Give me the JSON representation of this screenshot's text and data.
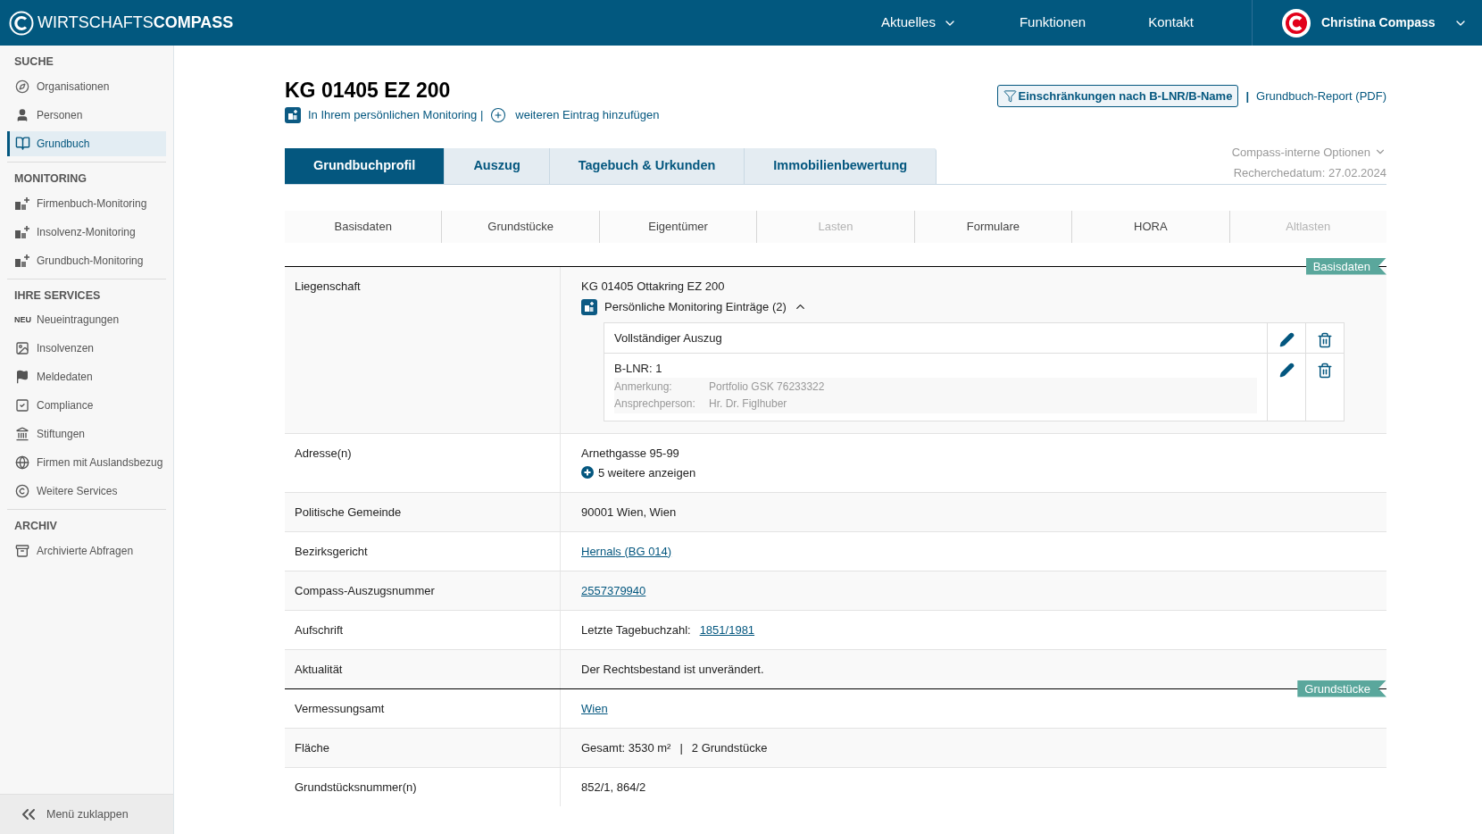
{
  "header": {
    "logo": {
      "light": "WIRTSCHAFTS",
      "bold": "COMPASS"
    },
    "nav": [
      {
        "label": "Aktuelles",
        "dropdown": true
      },
      {
        "label": "Funktionen",
        "dropdown": false
      },
      {
        "label": "Kontakt",
        "dropdown": false
      }
    ],
    "user": {
      "name": "Christina Compass"
    }
  },
  "sidebar": {
    "sections": [
      {
        "title": "SUCHE",
        "items": [
          {
            "label": "Organisationen",
            "selected": false
          },
          {
            "label": "Personen",
            "selected": false
          },
          {
            "label": "Grundbuch",
            "selected": true
          }
        ]
      },
      {
        "title": "MONITORING",
        "items": [
          {
            "label": "Firmenbuch-Monitoring",
            "selected": false
          },
          {
            "label": "Insolvenz-Monitoring",
            "selected": false
          },
          {
            "label": "Grundbuch-Monitoring",
            "selected": false
          }
        ]
      },
      {
        "title": "IHRE SERVICES",
        "items": [
          {
            "label": "Neueintragungen",
            "badge": "NEU",
            "selected": false
          },
          {
            "label": "Insolvenzen",
            "selected": false
          },
          {
            "label": "Meldedaten",
            "selected": false
          },
          {
            "label": "Compliance",
            "selected": false
          },
          {
            "label": "Stiftungen",
            "selected": false
          },
          {
            "label": "Firmen mit Auslandsbezug",
            "selected": false
          },
          {
            "label": "Weitere Services",
            "selected": false
          }
        ]
      },
      {
        "title": "ARCHIV",
        "items": [
          {
            "label": "Archivierte Abfragen",
            "selected": false
          }
        ]
      }
    ],
    "collapse": "Menü zuklappen"
  },
  "page": {
    "title": "KG 01405 EZ 200",
    "monitoring_link": "In Ihrem persönlichen Monitoring |",
    "add_link": "weiteren Eintrag hinzufügen",
    "filter_button": "Einschränkungen nach B-LNR/B-Name",
    "separator": "|",
    "report_link": "Grundbuch-Report (PDF)",
    "tabs": [
      {
        "label": "Grundbuchprofil",
        "selected": true
      },
      {
        "label": "Auszug",
        "selected": false
      },
      {
        "label": "Tagebuch & Urkunden",
        "selected": false
      },
      {
        "label": "Immobilienbewertung",
        "selected": false
      }
    ],
    "options": "Compass-interne Optionen",
    "research_date": "Recherchedatum: 27.02.2024",
    "subtabs": [
      {
        "label": "Basisdaten",
        "disabled": false
      },
      {
        "label": "Grundstücke",
        "disabled": false
      },
      {
        "label": "Eigentümer",
        "disabled": false
      },
      {
        "label": "Lasten",
        "disabled": true
      },
      {
        "label": "Formulare",
        "disabled": false
      },
      {
        "label": "HORA",
        "disabled": false
      },
      {
        "label": "Altlasten",
        "disabled": true
      }
    ],
    "rows": [
      {
        "label": "Liegenschaft",
        "section": "Basisdaten",
        "value": [
          {
            "text": "KG 01405 Ottakring EZ 200",
            "link": false
          }
        ],
        "monitoring": {
          "title": "Persönliche Monitoring Einträge (2)",
          "expanded": true,
          "entries": [
            {
              "title": "Vollständiger Auszug"
            },
            {
              "title": "B-LNR: 1",
              "details": [
                {
                  "label": "Anmerkung:",
                  "value": "Portfolio GSK 76233322"
                },
                {
                  "label": "Ansprechperson:",
                  "value": "Hr. Dr. Figlhuber"
                }
              ]
            }
          ]
        }
      },
      {
        "label": "Adresse(n)",
        "value": [
          {
            "text": "Arnethgasse 95-99",
            "link": false
          }
        ],
        "more": "5 weitere anzeigen"
      },
      {
        "label": "Politische Gemeinde",
        "value": [
          {
            "text": "90001 Wien, Wien",
            "link": false
          }
        ]
      },
      {
        "label": "Bezirksgericht",
        "value": [
          {
            "text": "Hernals (BG 014)",
            "link": true
          }
        ]
      },
      {
        "label": "Compass-Auszugsnummer",
        "value": [
          {
            "text": "2557379940",
            "link": true
          }
        ]
      },
      {
        "label": "Aufschrift",
        "value": [
          {
            "text": "Letzte Tagebuchzahl:",
            "link": false
          },
          {
            "text": "1851/1981",
            "link": true
          }
        ]
      },
      {
        "label": "Aktualität",
        "value": [
          {
            "text": "Der Rechtsbestand ist unverändert.",
            "link": false
          }
        ]
      },
      {
        "label": "Vermessungsamt",
        "section": "Grundstücke",
        "value": [
          {
            "text": "Wien",
            "link": true
          }
        ]
      },
      {
        "label": "Fläche",
        "value": [
          {
            "text": "Gesamt: 3530 m²",
            "link": false
          },
          {
            "text": "|",
            "link": false
          },
          {
            "text": "2 Grundstücke",
            "link": false
          }
        ]
      },
      {
        "label": "Grundstücksnummer(n)",
        "value": [
          {
            "text": "852/1, 864/2",
            "link": false
          }
        ]
      }
    ]
  }
}
